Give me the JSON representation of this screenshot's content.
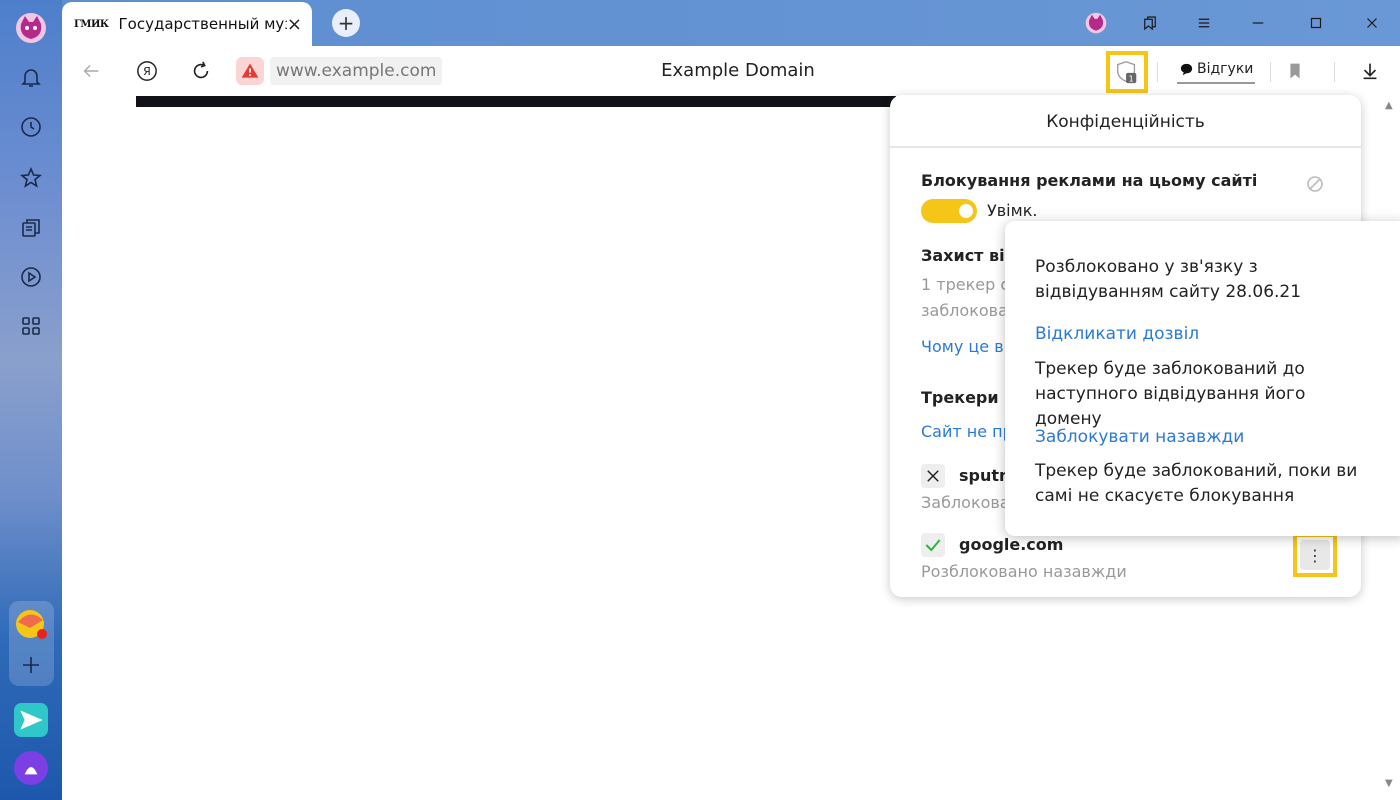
{
  "tab": {
    "favicon_text": "ГМИК",
    "title": "Государственный музей",
    "close": "×"
  },
  "toolbar": {
    "url": "www.example.com",
    "page_title": "Example Domain",
    "yandex_letter": "Я",
    "feedback_label": "Відгуки",
    "shield_count": "1"
  },
  "panel": {
    "title": "Конфіденційність",
    "ad_block_title": "Блокування реклами на цьому сайті",
    "ad_block_state": "Увімк.",
    "protection_title": "Захист від",
    "trackers_blocked_line1": "1 трекер с",
    "trackers_blocked_line2": "заблокова",
    "why_link": "Чому це в",
    "trackers_title": "Трекери н",
    "site_link": "Сайт не пр",
    "tracker1_name": "sputn",
    "tracker1_status": "Заблокова",
    "tracker2_name": "google.com",
    "tracker2_status": "Розблоковано назавжди"
  },
  "popup": {
    "unblocked_info": "Розблоковано у зв'язку з відвідуванням сайту 28.06.21",
    "revoke_link": "Відкликати дозвіл",
    "revoke_desc": "Трекер буде заблокований до наступного відвідування його домену",
    "block_forever_link": "Заблокувати назавжди",
    "block_forever_desc": "Трекер буде заблокований, поки ви самі не скасуєте блокування"
  },
  "colors": {
    "accent": "#f5c518",
    "link": "#2a7ad6",
    "sidebar_top": "#4d7fcb"
  }
}
